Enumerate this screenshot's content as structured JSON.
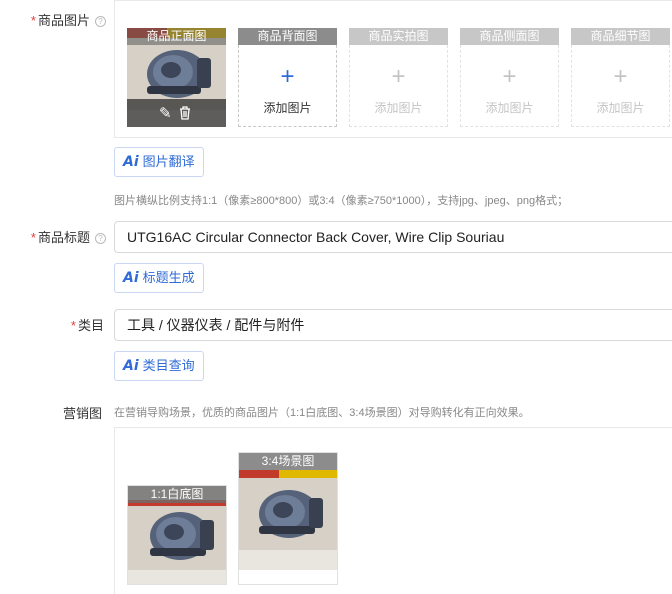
{
  "product_images": {
    "label": "商品图片",
    "help": "?",
    "slots": [
      {
        "title": "商品正面图",
        "add": ""
      },
      {
        "title": "商品背面图",
        "add": "添加图片"
      },
      {
        "title": "商品实拍图",
        "add": "添加图片"
      },
      {
        "title": "商品侧面图",
        "add": "添加图片"
      },
      {
        "title": "商品细节图",
        "add": "添加图片"
      }
    ],
    "plus": "+",
    "edit_icon": "✎",
    "delete_icon": "🗑",
    "translate_button": "图片翻译",
    "hint": "图片横纵比例支持1:1（像素≥800*800）或3:4（像素≥750*1000），支持jpg、jpeg、png格式；"
  },
  "title_field": {
    "label": "商品标题",
    "help": "?",
    "value": "UTG16AC Circular Connector Back Cover, Wire Clip Souriau",
    "generate_button": "标题生成"
  },
  "category_field": {
    "label": "类目",
    "value": "工具 / 仪器仪表 / 配件与附件",
    "query_button": "类目查询"
  },
  "marketing": {
    "label": "营销图",
    "hint": "在营销导购场景，优质的商品图片（1:1白底图、3:4场景图）对导购转化有正向效果。",
    "images": [
      {
        "title": "1:1白底图"
      },
      {
        "title": "3:4场景图"
      }
    ]
  },
  "required_mark": "*",
  "ai_icon": "Ai",
  "colors": {
    "accent": "#2f6bd6",
    "required": "#e23c39",
    "slot_header": "#8c8c8c"
  }
}
